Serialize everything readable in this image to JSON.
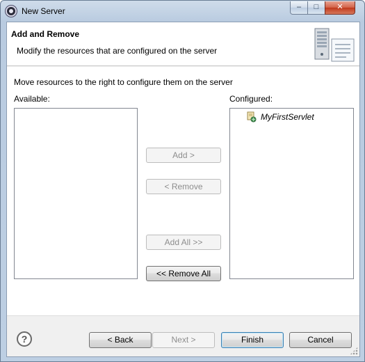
{
  "window": {
    "title": "New Server",
    "minimize_glyph": "–",
    "maximize_glyph": "□",
    "close_glyph": "✕"
  },
  "header": {
    "title": "Add and Remove",
    "description": "Modify the resources that are configured on the server"
  },
  "body": {
    "instructions": "Move resources to the right to configure them on the server",
    "available_label": "Available:",
    "configured_label": "Configured:",
    "available_items": [],
    "configured_items": [
      {
        "label": "MyFirstServlet",
        "icon": "web-module-icon"
      }
    ]
  },
  "transfer_buttons": {
    "add": "Add >",
    "remove": "< Remove",
    "add_all": "Add All >>",
    "remove_all": "<< Remove All"
  },
  "footer": {
    "help_glyph": "?",
    "back": "< Back",
    "next": "Next >",
    "finish": "Finish",
    "cancel": "Cancel"
  }
}
